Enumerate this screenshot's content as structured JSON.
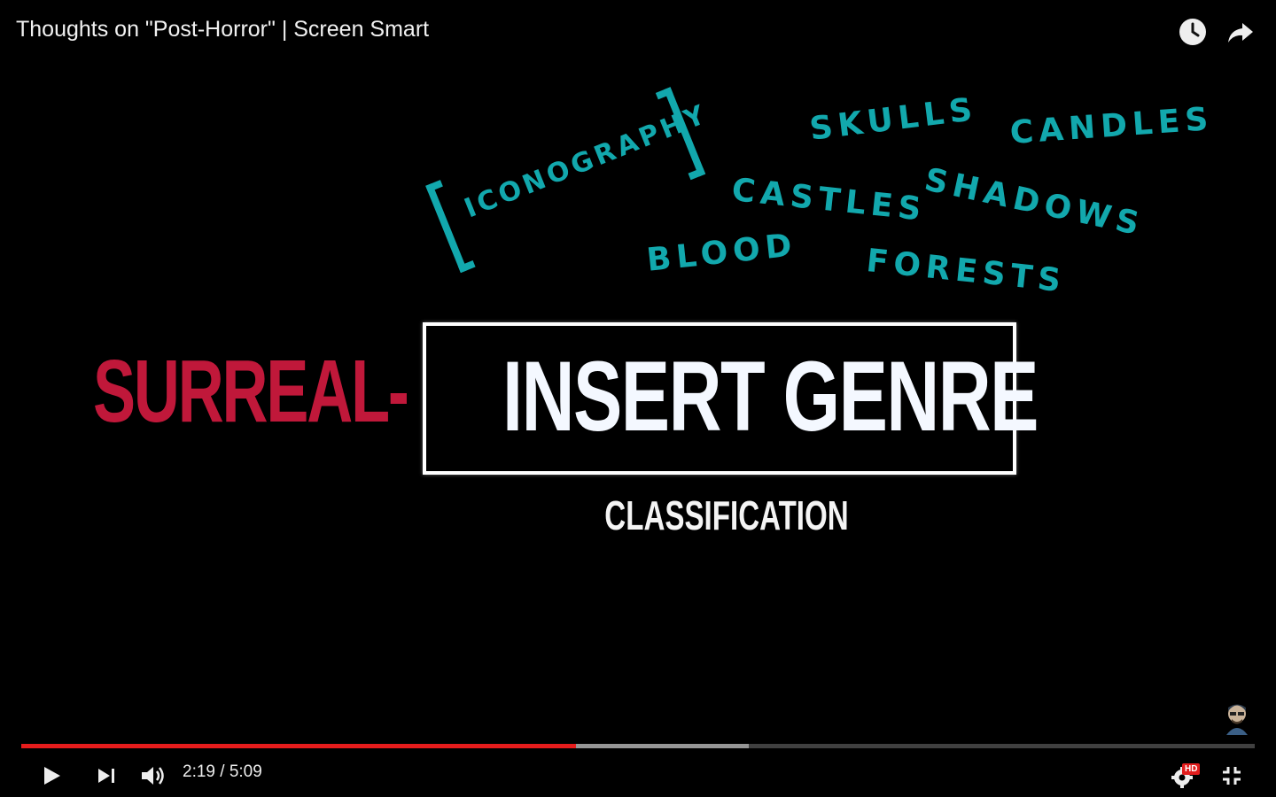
{
  "player": {
    "title": "Thoughts on \"Post-Horror\" | Screen Smart",
    "icons": {
      "watch_later": "clock-icon",
      "share": "share-arrow-icon"
    }
  },
  "frame": {
    "iconography": "ICONOGRAPHY",
    "words": {
      "skulls": "SKULLS",
      "candles": "CANDLES",
      "castles": "CASTLES",
      "shadows": "SHADOWS",
      "blood": "BLOOD",
      "forests": "FORESTS"
    },
    "prefix": "SURREAL-",
    "genre": "INSERT GENRE",
    "classification": "CLASSIFICATION",
    "colors": {
      "teal": "#12a8ad",
      "red": "#c0183a"
    }
  },
  "controls": {
    "time": "2:19 / 5:09",
    "played_fraction": 0.45,
    "loaded_fraction": 0.59,
    "hd_badge": "HD",
    "icons": [
      "play-icon",
      "next-icon",
      "volume-icon",
      "settings-icon",
      "exit-fullscreen-icon"
    ],
    "progress_color": "#e61c1c"
  }
}
